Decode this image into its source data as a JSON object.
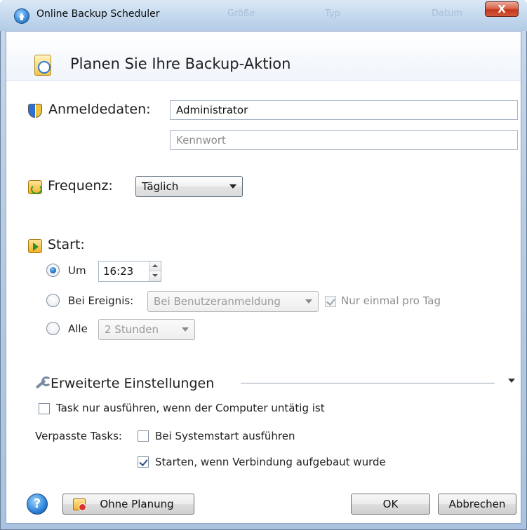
{
  "window": {
    "title": "Online Backup Scheduler",
    "background_columns": [
      "Größe",
      "Typ",
      "Datum"
    ],
    "close_label": "X"
  },
  "header": {
    "title": "Planen Sie Ihre Backup-Aktion"
  },
  "credentials": {
    "label": "Anmeldedaten:",
    "username_value": "Administrator",
    "password_placeholder": "Kennwort"
  },
  "frequency": {
    "label": "Frequenz:",
    "selected": "Täglich"
  },
  "start": {
    "label": "Start:",
    "options": {
      "at": {
        "label": "Um",
        "time": "16:23",
        "checked": true
      },
      "on_event": {
        "label": "Bei Ereignis:",
        "event": "Bei Benutzeranmeldung",
        "once_per_day_label": "Nur einmal pro Tag",
        "once_per_day_checked": true,
        "checked": false
      },
      "every": {
        "label": "Alle",
        "interval": "2 Stunden",
        "checked": false
      }
    }
  },
  "advanced": {
    "label": "Erweiterte Einstellungen",
    "idle_only_label": "Task nur ausführen, wenn der Computer untätig ist",
    "idle_only_checked": false,
    "missed_tasks_label": "Verpasste Tasks:",
    "run_at_startup_label": "Bei Systemstart ausführen",
    "run_at_startup_checked": false,
    "start_on_connection_label": "Starten, wenn Verbindung aufgebaut wurde",
    "start_on_connection_checked": true
  },
  "footer": {
    "help_label": "?",
    "no_schedule_label": "Ohne Planung",
    "ok_label": "OK",
    "cancel_label": "Abbrechen"
  }
}
